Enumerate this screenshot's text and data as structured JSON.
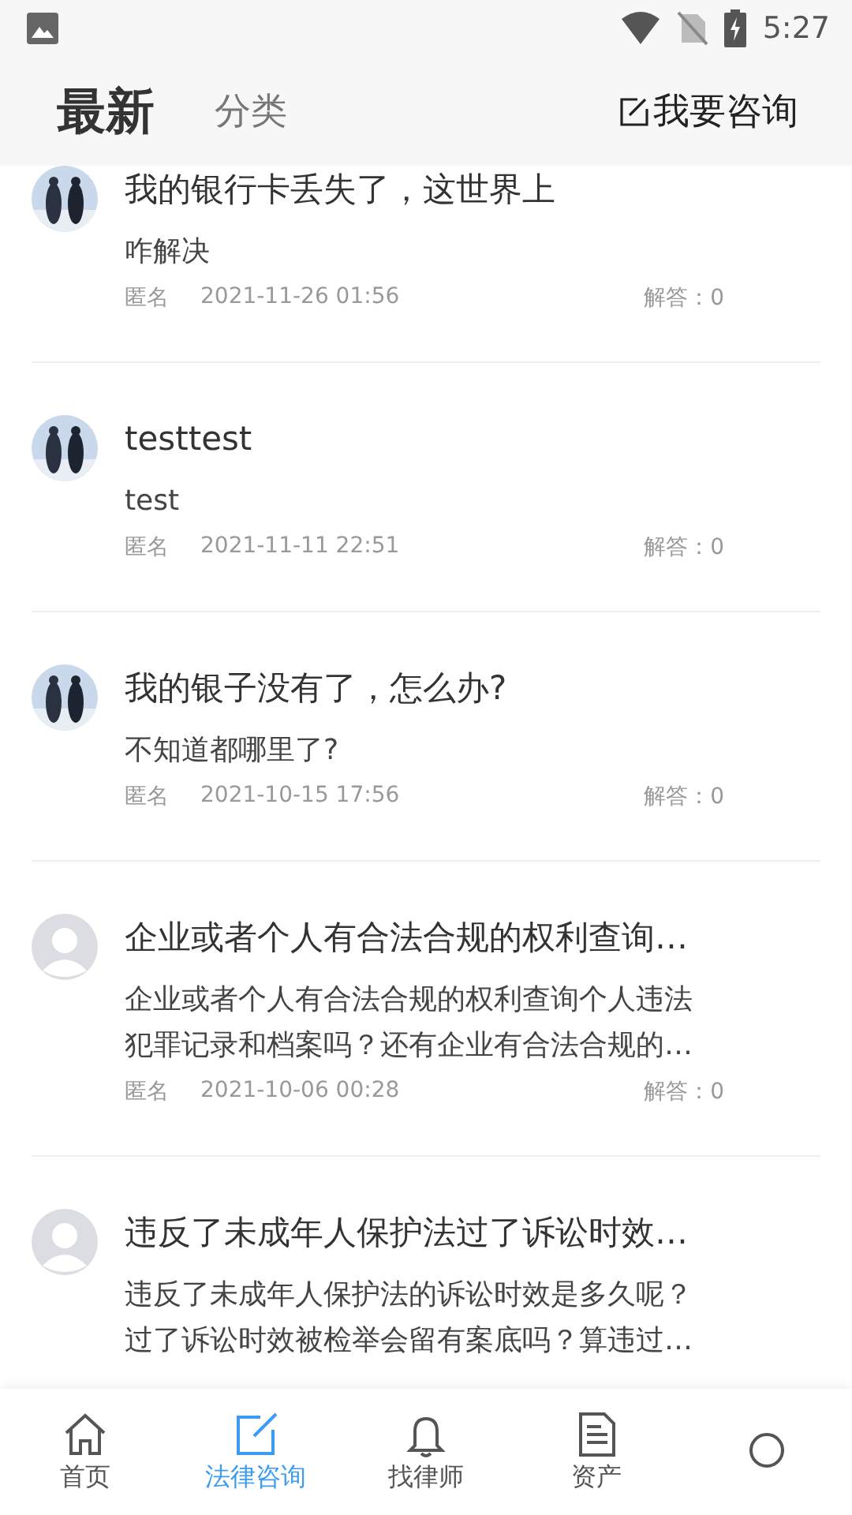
{
  "status_bar": {
    "time": "5:27"
  },
  "header": {
    "tabs": [
      {
        "label": "最新",
        "selected": true
      },
      {
        "label": "分类",
        "selected": false
      }
    ],
    "action": "我要咨询"
  },
  "questions": [
    {
      "title": "我的银行卡丢失了，这世界上",
      "description": "咋解决",
      "author": "匿名",
      "date": "2021-11-26 01:56",
      "answers": "解答：0"
    },
    {
      "title": "testtest",
      "description": "test",
      "author": "匿名",
      "date": "2021-11-11 22:51",
      "answers": "解答：0"
    },
    {
      "title": "我的银子没有了，怎么办?",
      "description": "不知道都哪里了?",
      "author": "匿名",
      "date": "2021-10-15 17:56",
      "answers": "解答：0"
    },
    {
      "avatar": {
        "kind": "default"
      },
      "title": "企业或者个人有合法合规的权利查询…",
      "description": "企业或者个人有合法合规的权利查询个人违法犯罪记录和档案吗？还有企业有合法合规的…",
      "author": "匿名",
      "date": "2021-10-06 00:28",
      "answers": "解答：0"
    },
    {
      "avatar": {
        "kind": "default"
      },
      "title": "违反了未成年人保护法过了诉讼时效…",
      "description": "违反了未成年人保护法的诉讼时效是多久呢？过了诉讼时效被检举会留有案底吗？算违过…"
    }
  ],
  "bottom_nav": [
    {
      "label": "首页",
      "selected": false
    },
    {
      "label": "法律咨询",
      "selected": true
    },
    {
      "label": "找律师",
      "selected": false
    },
    {
      "label": "资产",
      "selected": false
    },
    {
      "selected": false
    }
  ]
}
